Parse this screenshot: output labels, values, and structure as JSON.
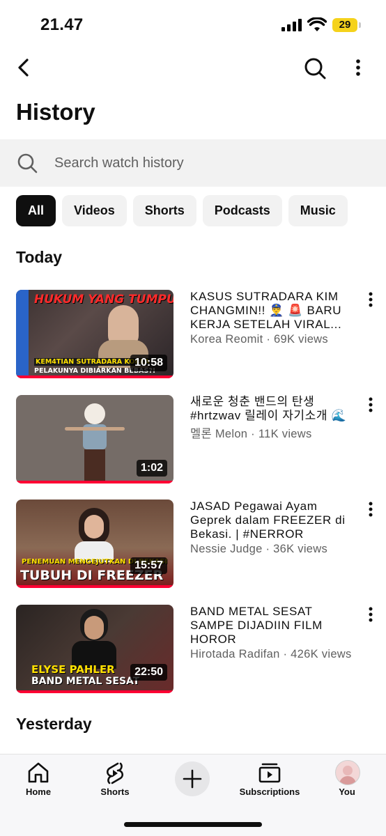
{
  "status_bar": {
    "time": "21.47",
    "battery": "29"
  },
  "header": {
    "title": "History"
  },
  "search": {
    "placeholder": "Search watch history"
  },
  "chips": [
    "All",
    "Videos",
    "Shorts",
    "Podcasts",
    "Music"
  ],
  "sections": {
    "today": "Today",
    "yesterday": "Yesterday"
  },
  "videos": [
    {
      "title": "KASUS SUTRADARA KIM CHANGMIN!! 👮‍♂️ 🚨 BARU KERJA SETELAH VIRAL...",
      "meta": "Korea Reomit · 69K views",
      "duration": "10:58",
      "thumb_lines": [
        "HUKUM YANG TUMPUL",
        "KEM4TIAN SUTRADARA KOREA",
        "PELAKUNYA DIBIARKAN BEBAS?!"
      ]
    },
    {
      "title": "새로운 청춘 밴드의 탄생 #hrtzwav 릴레이 자기소개 🌊",
      "meta": "멜론 Melon · 11K views",
      "duration": "1:02"
    },
    {
      "title": "JASAD Pegawai Ayam Geprek dalam FREEZER di Bekasi. | #NERROR",
      "meta": "Nessie Judge · 36K views",
      "duration": "15:57",
      "thumb_lines": [
        "PENEMUAN MENGEJUTKAN DI BEKASI",
        "TUBUH DI FREEZER"
      ]
    },
    {
      "title": "BAND METAL SESAT SAMPE DIJADIIN FILM HOROR",
      "meta": "Hirotada Radifan · 426K views",
      "duration": "22:50",
      "thumb_lines": [
        "ELYSE PAHLER",
        "BAND METAL SESAT"
      ]
    }
  ],
  "nav": {
    "home": "Home",
    "shorts": "Shorts",
    "subscriptions": "Subscriptions",
    "you": "You"
  },
  "colors": {
    "accent": "#ff0033",
    "chip_active": "#0f0f0f",
    "chip_bg": "#f2f2f2"
  }
}
